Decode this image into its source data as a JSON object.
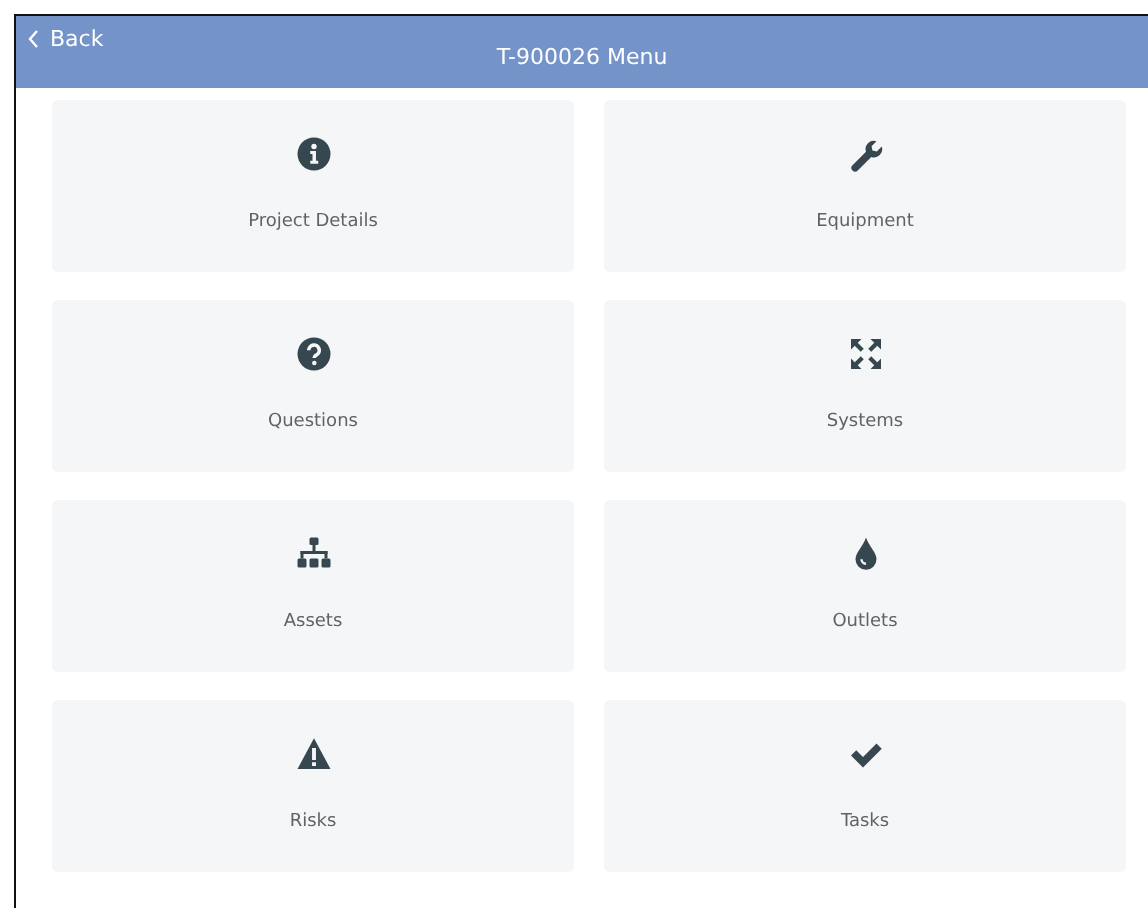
{
  "header": {
    "back": "Back",
    "title": "T-900026 Menu"
  },
  "tiles": [
    {
      "label": "Project Details"
    },
    {
      "label": "Equipment"
    },
    {
      "label": "Questions"
    },
    {
      "label": "Systems"
    },
    {
      "label": "Assets"
    },
    {
      "label": "Outlets"
    },
    {
      "label": "Risks"
    },
    {
      "label": "Tasks"
    }
  ]
}
